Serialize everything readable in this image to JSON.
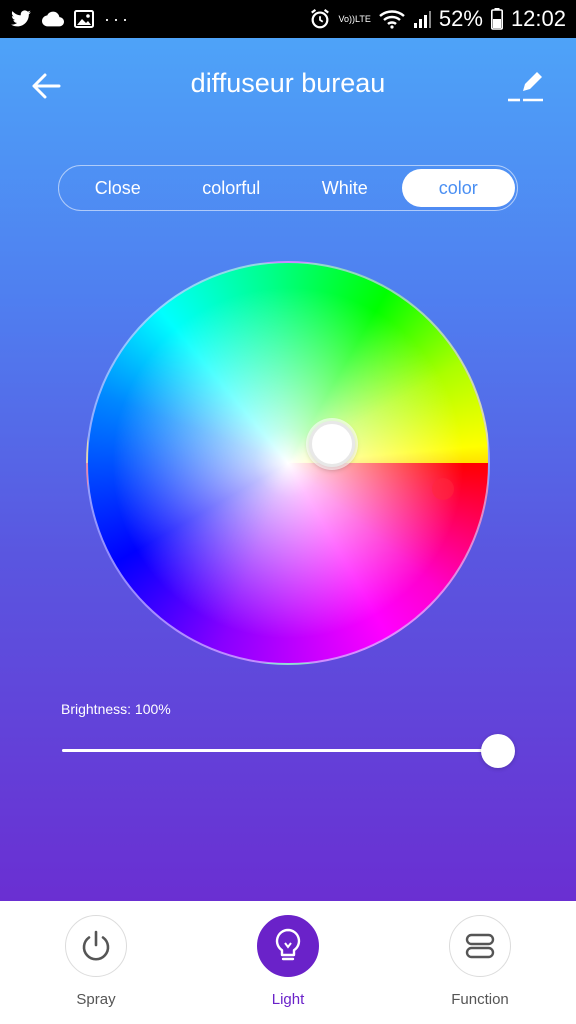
{
  "status_bar": {
    "left_icons": [
      "twitter-icon",
      "cloud-icon",
      "image-icon",
      "more-dots-icon"
    ],
    "dots": "···",
    "alarm_icon": "alarm-icon",
    "volte_top": "Vo))",
    "volte_bottom": "LTE",
    "battery_percent": "52%",
    "time": "12:02"
  },
  "header": {
    "title": "diffuseur bureau",
    "back_icon": "arrow-left-icon",
    "edit_icon": "edit-icon"
  },
  "mode_tabs": [
    {
      "label": "Close",
      "active": false
    },
    {
      "label": "colorful",
      "active": false
    },
    {
      "label": "White",
      "active": false
    },
    {
      "label": "color",
      "active": true
    }
  ],
  "brightness": {
    "label": "Brightness: 100%",
    "value": 1.0
  },
  "bottom_nav": [
    {
      "label": "Spray",
      "icon": "power-icon",
      "active": false
    },
    {
      "label": "Light",
      "icon": "bulb-icon",
      "active": true
    },
    {
      "label": "Function",
      "icon": "function-icon",
      "active": false
    }
  ],
  "colors": {
    "accent_purple": "#6a22c9",
    "tab_active_text": "#4a8ff3",
    "gradient_top": "#4ea3f8",
    "gradient_bottom": "#6a2fd2"
  }
}
